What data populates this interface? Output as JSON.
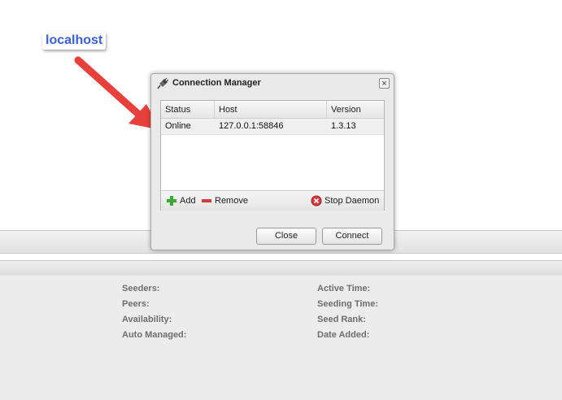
{
  "annotation": {
    "label": "localhost",
    "color": "#3a5fe0",
    "arrow_color": "#e8403a"
  },
  "dialog": {
    "title": "Connection Manager",
    "columns": [
      "Status",
      "Host",
      "Version"
    ],
    "rows": [
      {
        "status": "Online",
        "host": "127.0.0.1:58846",
        "version": "1.3.13"
      }
    ],
    "footer": {
      "add": "Add",
      "remove": "Remove",
      "stop_daemon": "Stop Daemon"
    },
    "buttons": {
      "close": "Close",
      "connect": "Connect"
    }
  },
  "details": {
    "left": [
      "Seeders:",
      "Peers:",
      "Availability:",
      "Auto Managed:"
    ],
    "right": [
      "Active Time:",
      "Seeding Time:",
      "Seed Rank:",
      "Date Added:"
    ]
  }
}
